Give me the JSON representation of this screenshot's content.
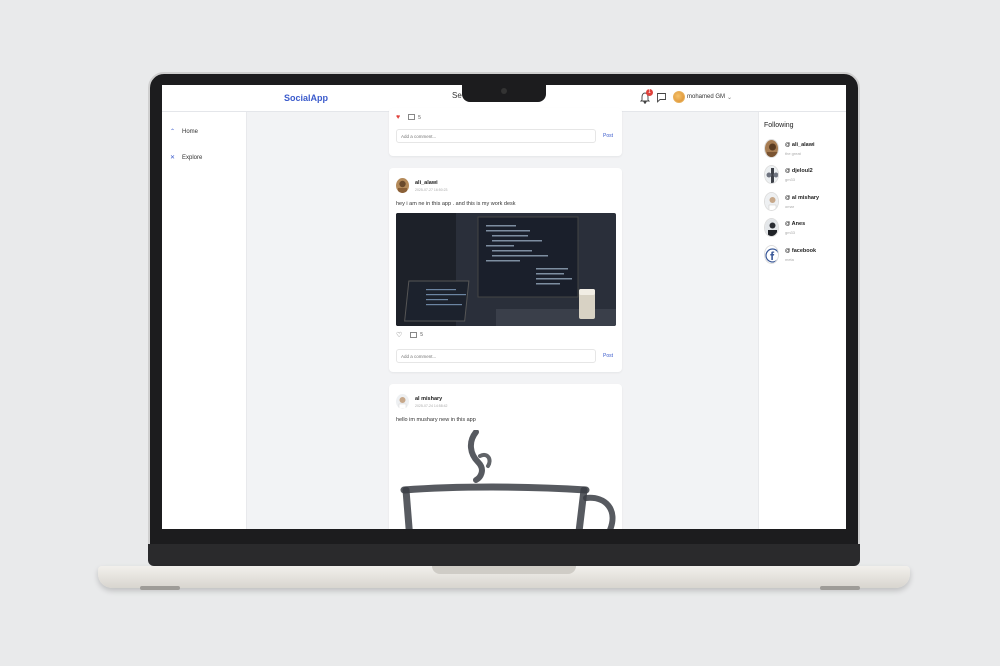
{
  "app": {
    "logo": "SocialApp",
    "search_text": "Se",
    "notification_count": "1",
    "user_name": "mohamed GM"
  },
  "sidebar": {
    "items": [
      {
        "label": "Home",
        "icon": "home-icon"
      },
      {
        "label": "Explore",
        "icon": "explore-icon"
      }
    ]
  },
  "following": {
    "title": "Following",
    "users": [
      {
        "name": "@ ali_alawi",
        "sub": "the great"
      },
      {
        "name": "@ djeloul2",
        "sub": "gm33"
      },
      {
        "name": "@ al mishary",
        "sub": "omar"
      },
      {
        "name": "@ Anes",
        "sub": "gm33"
      },
      {
        "name": "@ facebook",
        "sub": "meta"
      }
    ]
  },
  "feed": {
    "comment_placeholder": "Add a comment...",
    "post_label": "Post",
    "posts": [
      {
        "comments": "5",
        "liked": true
      },
      {
        "author": "ali_alawi",
        "timestamp": "2025-07-27 16:50:23",
        "text": "hey i am ne in this app . and this is my work desk",
        "comments": "5",
        "liked": false
      },
      {
        "author": "al mishary",
        "timestamp": "2025-07-24 14:58:42",
        "text": "hello im mushary new in this app"
      }
    ]
  },
  "colors": {
    "accent": "#3b5bcc",
    "heart_liked": "#e0413b",
    "badge": "#e0413b"
  }
}
